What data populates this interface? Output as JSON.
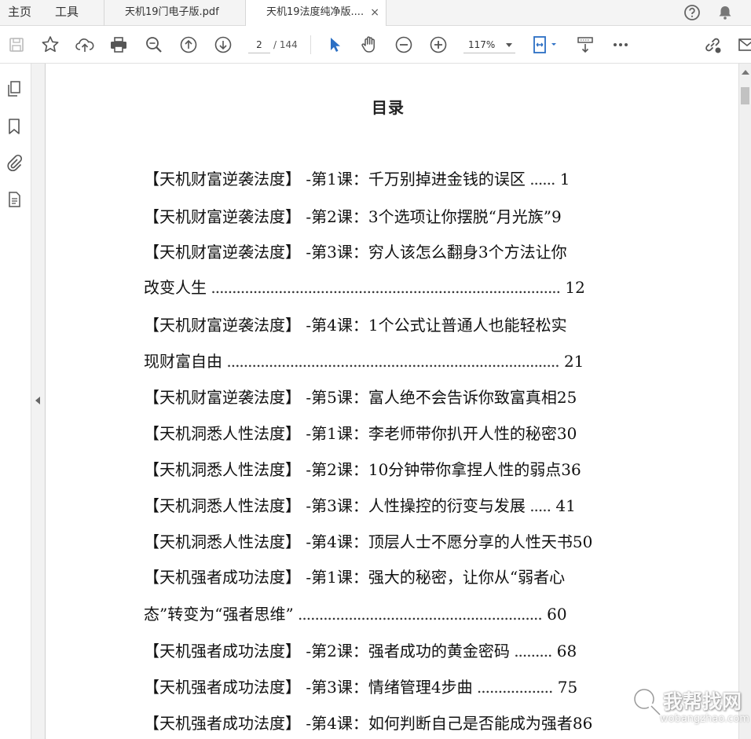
{
  "tabbar": {
    "home_label": "主页",
    "tools_label": "工具",
    "tabs": [
      {
        "label": "天机19门电子版.pdf"
      },
      {
        "label": "天机19法度纯净版....",
        "close": "×"
      }
    ]
  },
  "toolbar": {
    "current_page": "2",
    "page_total": "/ 144",
    "zoom": "117%",
    "accent_color": "#2b6fc4"
  },
  "document": {
    "title": "目录",
    "lines": [
      {
        "text": "【天机财富逆袭法度】 -第1课：千万别掉进金钱的误区",
        "leader": " ......",
        "page": " 1"
      },
      {
        "text": "【天机财富逆袭法度】 -第2课：3个选项让你摆脱“月光族”9",
        "leader": "",
        "page": ""
      },
      {
        "text": "【天机财富逆袭法度】 -第3课：穷人该怎么翻身3个方法让你",
        "leader": "",
        "page": ""
      },
      {
        "text": "改变人生",
        "leader": " ...................................................................................",
        "page": " 12"
      },
      {
        "text": "【天机财富逆袭法度】 -第4课：1个公式让普通人也能轻松实",
        "leader": "",
        "page": ""
      },
      {
        "text": "现财富自由",
        "leader": " ...............................................................................",
        "page": " 21"
      },
      {
        "text": "【天机财富逆袭法度】 -第5课：富人绝不会告诉你致富真相25",
        "leader": "",
        "page": ""
      },
      {
        "text": "【天机洞悉人性法度】 -第1课：李老师带你扒开人性的秘密30",
        "leader": "",
        "page": ""
      },
      {
        "text": "【天机洞悉人性法度】 -第2课：10分钟带你拿捏人性的弱点36",
        "leader": "",
        "page": ""
      },
      {
        "text": "【天机洞悉人性法度】 -第3课：人性操控的衍变与发展",
        "leader": " .....",
        "page": " 41"
      },
      {
        "text": "【天机洞悉人性法度】 -第4课：顶层人士不愿分享的人性天书50",
        "leader": "",
        "page": ""
      },
      {
        "text": "【天机强者成功法度】 -第1课：强大的秘密，让你从“弱者心",
        "leader": "",
        "page": ""
      },
      {
        "text": "态”转变为“强者思维”",
        "leader": " ..........................................................",
        "page": " 60"
      },
      {
        "text": "【天机强者成功法度】 -第2课：强者成功的黄金密码",
        "leader": " .........",
        "page": " 68"
      },
      {
        "text": "【天机强者成功法度】 -第3课：情绪管理4步曲",
        "leader": " ..................",
        "page": " 75"
      },
      {
        "text": "【天机强者成功法度】 -第4课：如何判断自己是否能成为强者86",
        "leader": "",
        "page": ""
      }
    ]
  },
  "watermark": {
    "text": "我帮找网",
    "url": "wobangzhao.com"
  }
}
